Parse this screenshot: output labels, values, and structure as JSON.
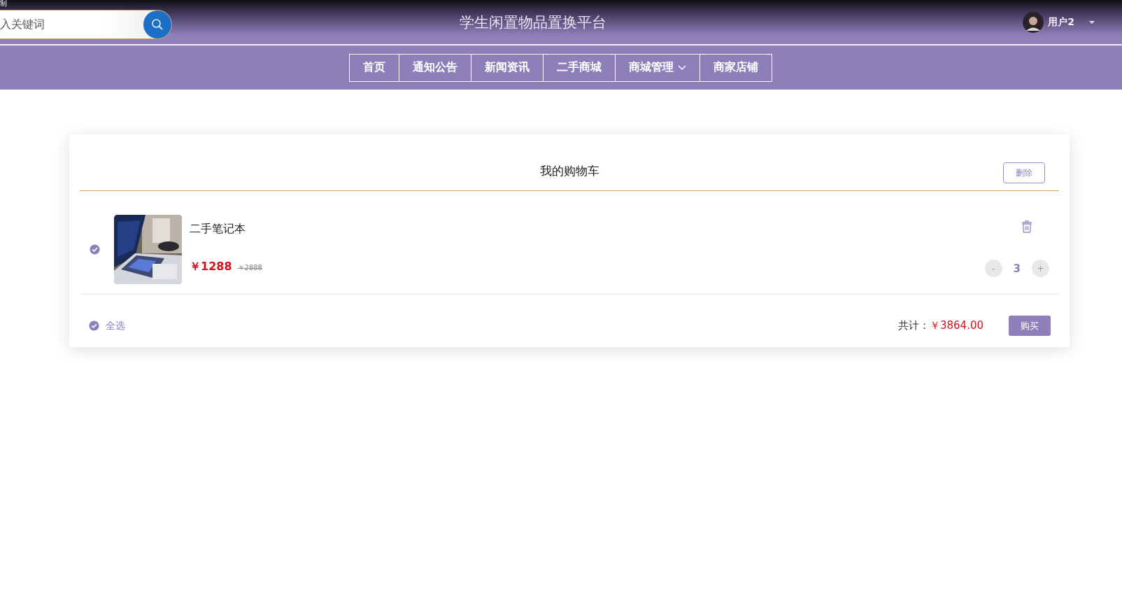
{
  "corner_text": "制",
  "search": {
    "placeholder": "入关键词"
  },
  "site_title": "学生闲置物品置换平台",
  "user": {
    "name": "用户2"
  },
  "nav": [
    {
      "label": "首页",
      "has_dropdown": false
    },
    {
      "label": "通知公告",
      "has_dropdown": false
    },
    {
      "label": "新闻资讯",
      "has_dropdown": false
    },
    {
      "label": "二手商城",
      "has_dropdown": false
    },
    {
      "label": "商城管理",
      "has_dropdown": true
    },
    {
      "label": "商家店铺",
      "has_dropdown": false
    }
  ],
  "cart": {
    "title": "我的购物车",
    "delete_button": "删除",
    "items": [
      {
        "checked": true,
        "kind": "picture",
        "name": "二手笔记本",
        "price": "￥1288",
        "original_price": "￥2888",
        "quantity": "3",
        "minus": "-",
        "plus": "+"
      }
    ],
    "select_all": {
      "label": "全选",
      "checked": true
    },
    "total_label": "共计：",
    "total": "￥3864.00",
    "buy_button": "购买"
  }
}
